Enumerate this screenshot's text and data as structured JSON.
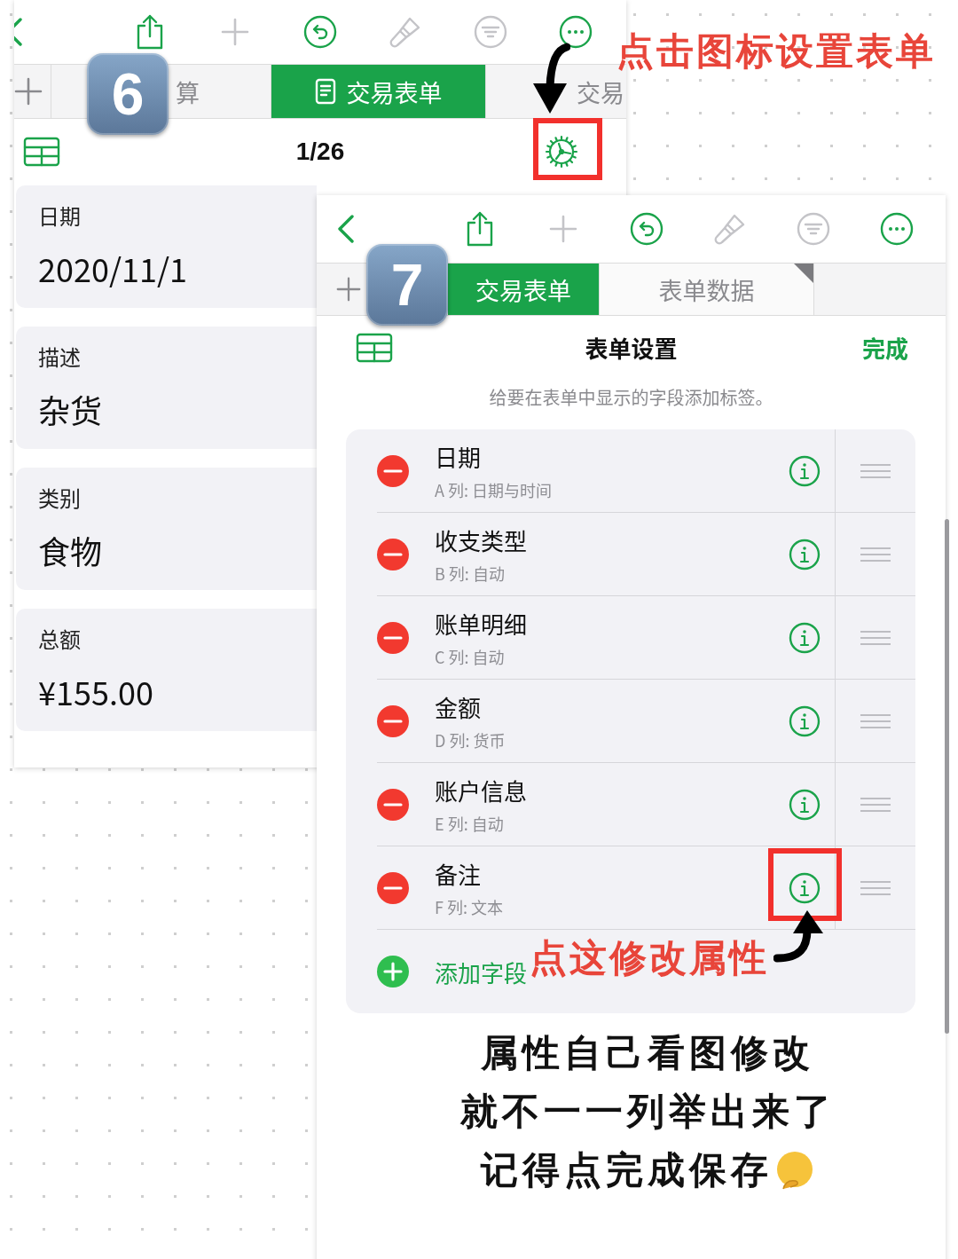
{
  "screen_back": {
    "step": "6",
    "toolbar": [
      {
        "kind": "back",
        "disabled": false
      },
      {
        "kind": "share",
        "disabled": false
      },
      {
        "kind": "add",
        "disabled": true
      },
      {
        "kind": "undo",
        "disabled": false
      },
      {
        "kind": "brush",
        "disabled": true
      },
      {
        "kind": "filter",
        "disabled": true
      },
      {
        "kind": "more",
        "disabled": false
      }
    ],
    "tabs": [
      {
        "label": "算",
        "selected": false
      },
      {
        "label": "交易表单",
        "selected": true
      },
      {
        "label": "交易",
        "selected": false
      }
    ],
    "record_counter": "1/26",
    "fields": [
      {
        "label": "日期",
        "value": "2020/11/1"
      },
      {
        "label": "描述",
        "value": "杂货"
      },
      {
        "label": "类别",
        "value": "食物"
      },
      {
        "label": "总额",
        "value": "¥155.00"
      }
    ]
  },
  "screen_front": {
    "step": "7",
    "toolbar": [
      {
        "kind": "back",
        "disabled": false
      },
      {
        "kind": "share",
        "disabled": false
      },
      {
        "kind": "add",
        "disabled": true
      },
      {
        "kind": "undo",
        "disabled": false
      },
      {
        "kind": "brush",
        "disabled": true
      },
      {
        "kind": "filter",
        "disabled": true
      },
      {
        "kind": "more",
        "disabled": false
      }
    ],
    "tabs": [
      {
        "label": "交易表单",
        "selected": true
      },
      {
        "label": "表单数据",
        "selected": false
      }
    ],
    "title": "表单设置",
    "done": "完成",
    "hint": "给要在表单中显示的字段添加标签。",
    "rows": [
      {
        "name": "日期",
        "column": "A 列: 日期与时间"
      },
      {
        "name": "收支类型",
        "column": "B 列: 自动"
      },
      {
        "name": "账单明细",
        "column": "C 列: 自动"
      },
      {
        "name": "金额",
        "column": "D 列: 货币"
      },
      {
        "name": "账户信息",
        "column": "E 列: 自动"
      },
      {
        "name": "备注",
        "column": "F 列: 文本"
      }
    ],
    "add_label": "添加字段"
  },
  "annotations": {
    "settings_note": "点击图标设置表单",
    "info_note": "点这修改属性",
    "caption": [
      "属性自己看图修改",
      "就不一一列举出来了",
      "记得点完成保存"
    ]
  }
}
